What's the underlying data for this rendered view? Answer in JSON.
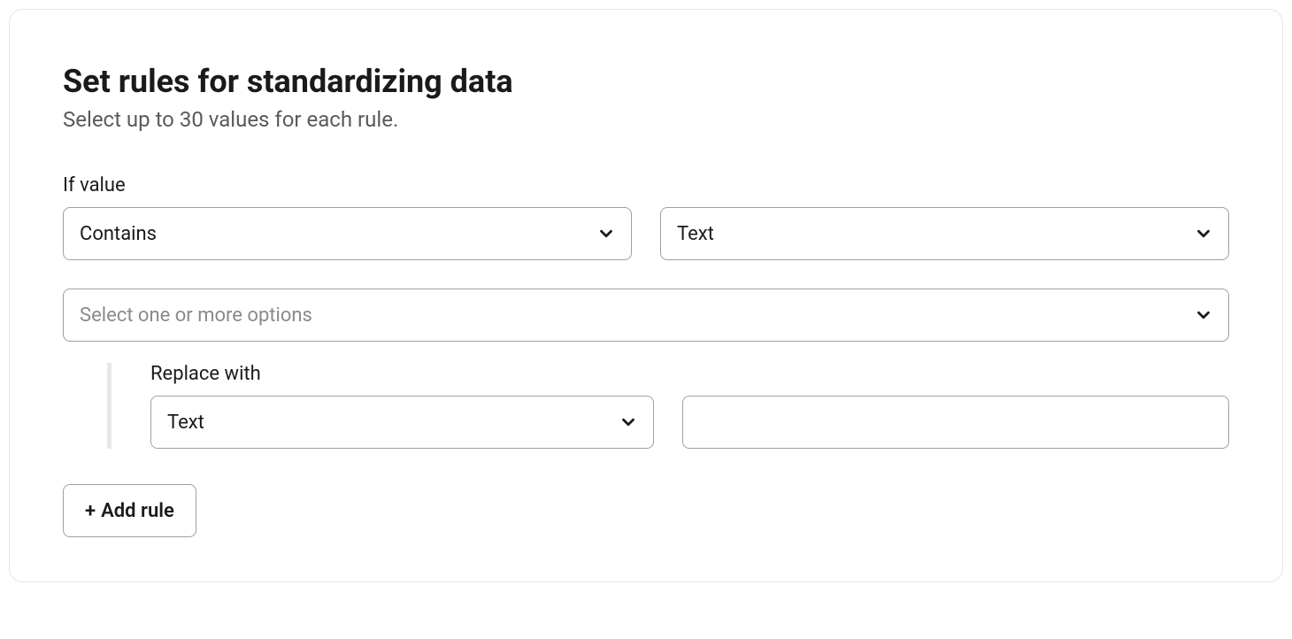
{
  "header": {
    "title": "Set rules for standardizing data",
    "subtitle": "Select up to 30 values for each rule."
  },
  "rule": {
    "if_value_label": "If value",
    "condition_select": "Contains",
    "type_select": "Text",
    "options_placeholder": "Select one or more options",
    "replace_label": "Replace with",
    "replace_type_select": "Text",
    "replace_value": ""
  },
  "actions": {
    "add_rule_label": "Add rule"
  }
}
